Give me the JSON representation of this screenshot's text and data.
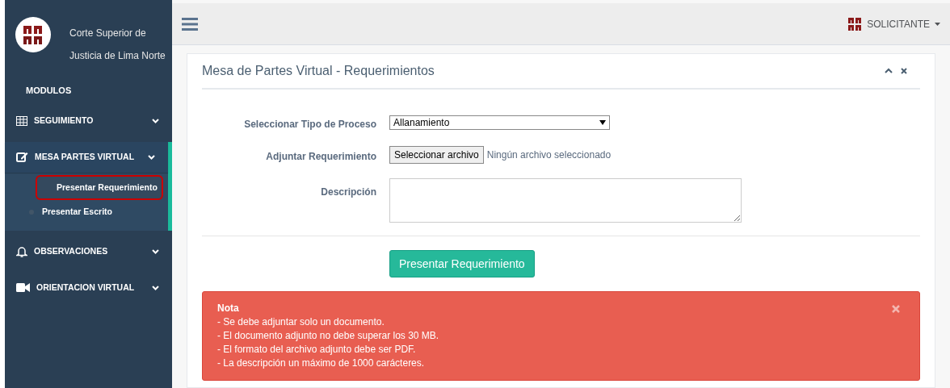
{
  "sidebar": {
    "org_name_lines": [
      "Corte Superior de",
      "Justicia de Lima Norte"
    ],
    "section_label": "MODULOS",
    "items": [
      {
        "label": "SEGUIMIENTO",
        "expanded": false
      },
      {
        "label": "MESA PARTES VIRTUAL",
        "expanded": true,
        "children": [
          {
            "label": "Presentar Requerimiento",
            "selected": true
          },
          {
            "label": "Presentar Escrito",
            "selected": false
          }
        ]
      },
      {
        "label": "OBSERVACIONES",
        "expanded": false
      },
      {
        "label": "ORIENTACION VIRTUAL",
        "expanded": false
      }
    ]
  },
  "topbar": {
    "user": "SOLICITANTE"
  },
  "panel": {
    "title": "Mesa de Partes Virtual - Requerimientos",
    "form": {
      "process_label": "Seleccionar Tipo de Proceso",
      "process_value": "Allanamiento",
      "attach_label": "Adjuntar Requerimiento",
      "file_button": "Seleccionar archivo",
      "file_status": "Ningún archivo seleccionado",
      "description_label": "Descripción"
    },
    "submit_button": "Presentar Requerimiento",
    "alert": {
      "title": "Nota",
      "lines": [
        "- Se debe adjuntar solo un documento.",
        "- El documento adjunto no debe superar los 30 MB.",
        "- El formato del archivo adjunto debe ser PDF.",
        "- La descripción un máximo de 1000 carácteres."
      ]
    }
  }
}
